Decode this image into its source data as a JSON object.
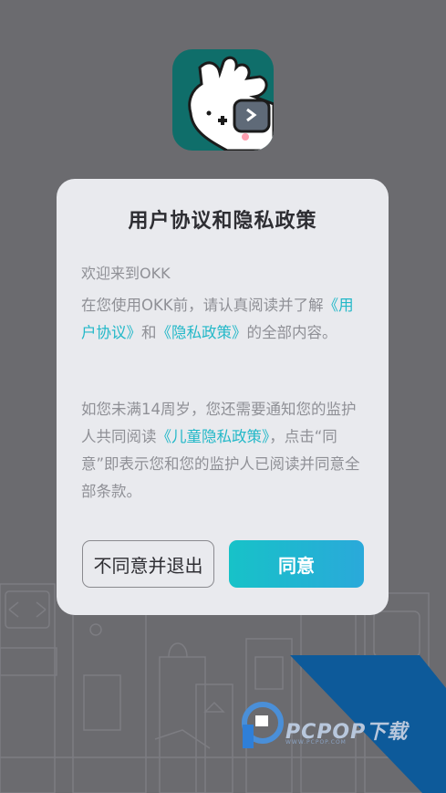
{
  "dialog": {
    "title": "用户协议和隐私政策",
    "welcome": "欢迎来到OKK",
    "p1_before": "在您使用OKK前，请认真阅读并了解",
    "p1_link1": "《用户协议》",
    "p1_mid": "和",
    "p1_link2": "《隐私政策》",
    "p1_after": "的全部内容。",
    "p2_before": " 如您未满14周岁，您还需要通知您的监护人共同阅读",
    "p2_link": "《儿童隐私政策》",
    "p2_after": "，点击“同意”即表示您和您的监护人已阅读并同意全部条款。",
    "decline_label": "不同意并退出",
    "agree_label": "同意"
  },
  "watermark": {
    "brand": "PCPOP下载",
    "sub": "WWW.PCPOP.COM"
  },
  "colors": {
    "link": "#22b8c8",
    "agree_start": "#17c2c8",
    "agree_end": "#2aa9da",
    "overlay": "#6b6b6f",
    "icon_bg": "#0f6e6a"
  },
  "icons": {
    "app": "okk-app-icon",
    "watermark": "pcpop-logo"
  }
}
